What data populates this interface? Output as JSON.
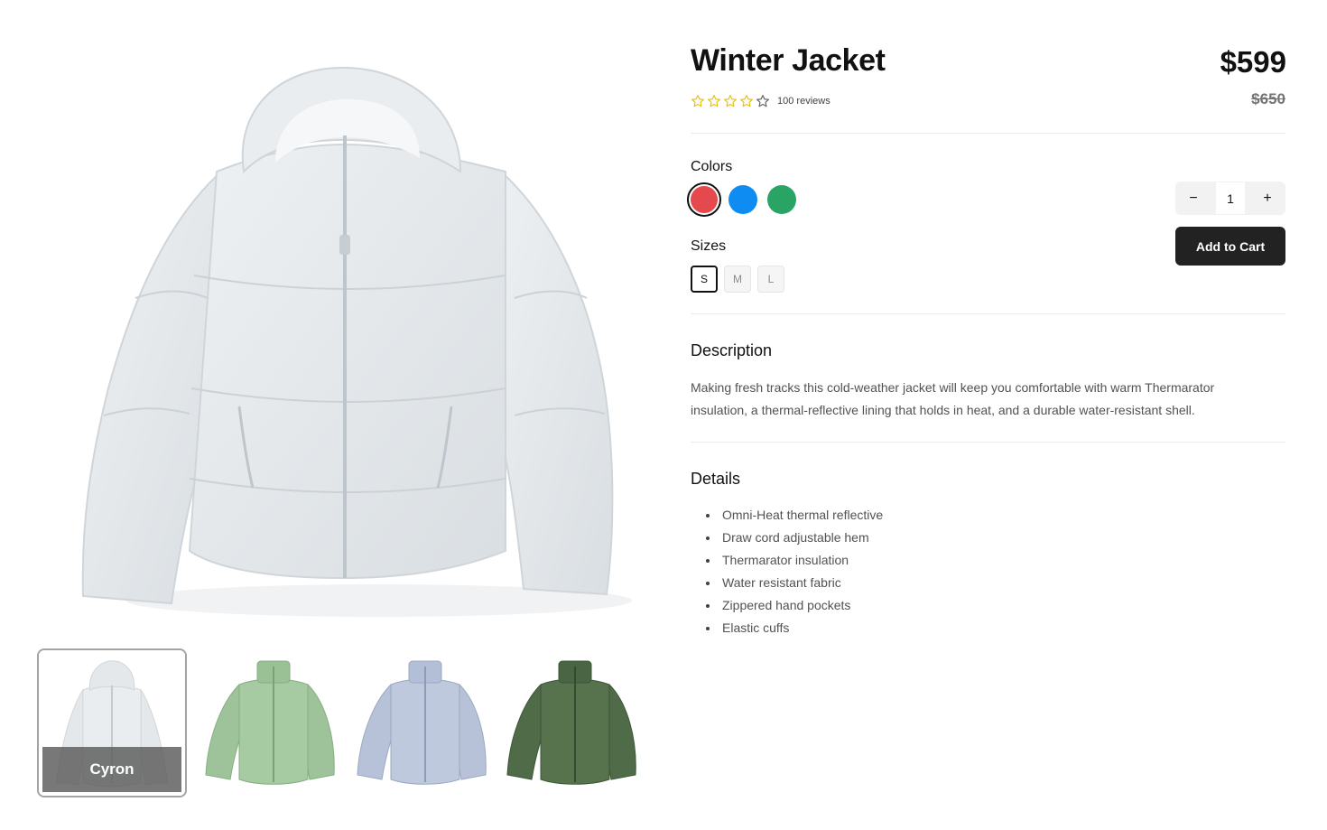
{
  "product": {
    "title": "Winter Jacket",
    "price": "$599",
    "original_price": "$650",
    "rating": {
      "value": 4,
      "max": 5,
      "reviews_label": "100 reviews"
    }
  },
  "colors": {
    "label": "Colors",
    "options": [
      {
        "name": "red",
        "hex": "#e5484d",
        "selected": true
      },
      {
        "name": "blue",
        "hex": "#0e8cf2",
        "selected": false
      },
      {
        "name": "green",
        "hex": "#2aa464",
        "selected": false
      }
    ]
  },
  "sizes": {
    "label": "Sizes",
    "options": [
      {
        "label": "S",
        "selected": true
      },
      {
        "label": "M",
        "selected": false
      },
      {
        "label": "L",
        "selected": false
      }
    ]
  },
  "quantity": {
    "minus": "−",
    "value": "1",
    "plus": "+"
  },
  "cart": {
    "label": "Add to Cart"
  },
  "description": {
    "heading": "Description",
    "text": "Making fresh tracks this cold-weather jacket will keep you comfortable with warm Thermarator insulation, a thermal-reflective lining that holds in heat, and a durable water-resistant shell."
  },
  "details": {
    "heading": "Details",
    "items": [
      "Omni-Heat thermal reflective",
      "Draw cord adjustable hem",
      "Thermarator insulation",
      "Water resistant fabric",
      "Zippered hand pockets",
      "Elastic cuffs"
    ]
  },
  "gallery": {
    "thumbnails": [
      {
        "caption": "Cyron",
        "color": "#e3e7ea",
        "selected": true
      },
      {
        "caption": "",
        "color": "#9ec39a",
        "selected": false
      },
      {
        "caption": "",
        "color": "#b7c2d9",
        "selected": false
      },
      {
        "caption": "",
        "color": "#4f6b47",
        "selected": false
      }
    ]
  },
  "colors_ui": {
    "star": "#e8c21a",
    "star_empty": "#666666",
    "accent": "#222222"
  }
}
